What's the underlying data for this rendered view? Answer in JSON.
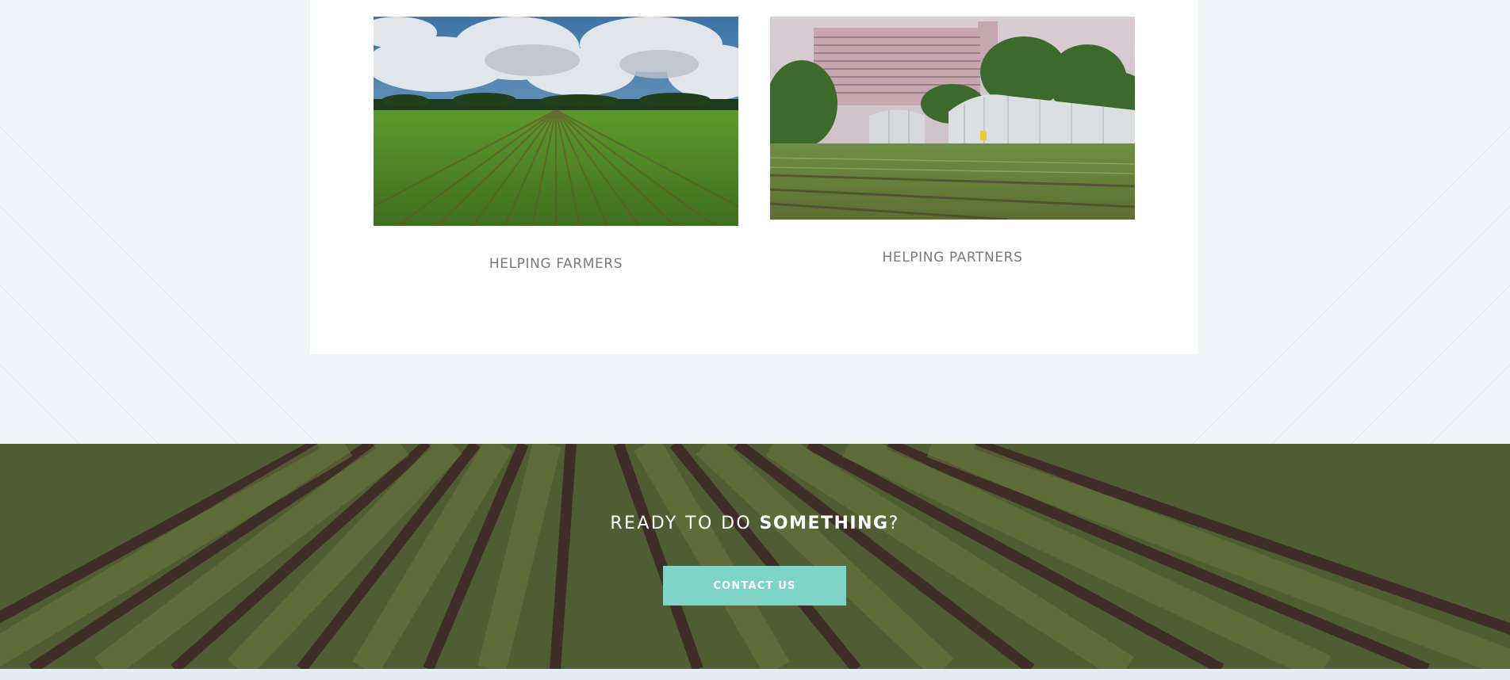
{
  "features": {
    "farmers": {
      "caption": "HELPING FARMERS",
      "image_description": "green crop rows under a cloudy blue sky"
    },
    "partners": {
      "caption": "HELPING PARTNERS",
      "image_description": "greenhouses and field in front of a tall building"
    }
  },
  "cta": {
    "heading_prefix": "READY TO DO ",
    "heading_emphasis": "SOMETHING",
    "heading_suffix": "?",
    "button_label": "CONTACT US",
    "background_description": "aerial rows of green potato plants"
  },
  "colors": {
    "page_background": "#f1f4f9",
    "card_background": "#ffffff",
    "caption_text": "#7a7a7a",
    "button_background": "#7fd4c8",
    "button_text": "#ffffff"
  }
}
